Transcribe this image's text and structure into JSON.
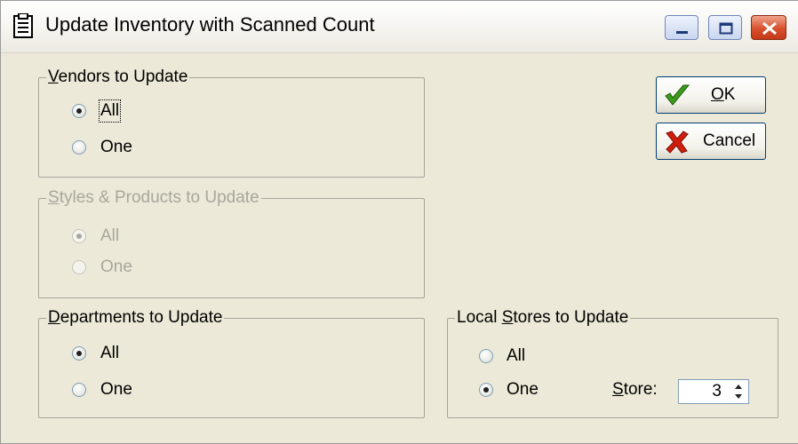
{
  "window": {
    "title": "Update Inventory with Scanned Count",
    "icon": "document-icon",
    "controls": [
      "minimize-icon",
      "maximize-icon",
      "close-icon"
    ]
  },
  "vendors": {
    "label_accel": "V",
    "label_rest": "endors to Update",
    "options": [
      {
        "label": "All",
        "selected": true
      },
      {
        "label": "One",
        "selected": false
      }
    ]
  },
  "styles": {
    "label_accel": "S",
    "label_rest": "tyles & Products to Update",
    "disabled": true,
    "options": [
      {
        "label": "All",
        "selected": true
      },
      {
        "label": "One",
        "selected": false
      }
    ]
  },
  "departments": {
    "label_accel": "D",
    "label_rest": "epartments to Update",
    "options": [
      {
        "label": "All",
        "selected": true
      },
      {
        "label": "One",
        "selected": false
      }
    ]
  },
  "stores": {
    "label_pre": "Local ",
    "label_accel": "S",
    "label_rest": "tores to Update",
    "options": [
      {
        "label": "All",
        "selected": false
      },
      {
        "label": "One",
        "selected": true
      }
    ],
    "store_label_accel": "S",
    "store_label_rest": "tore:",
    "store_value": "3"
  },
  "buttons": {
    "ok_accel": "O",
    "ok_rest": "K",
    "ok_icon": "checkmark-icon",
    "cancel_label": "Cancel",
    "cancel_icon": "red-x-icon"
  },
  "colors": {
    "title_close": "#d8502d",
    "ok_check": "#3c9a1c",
    "cancel_x": "#d01e0e",
    "disabled_text": "#a8a79b"
  }
}
